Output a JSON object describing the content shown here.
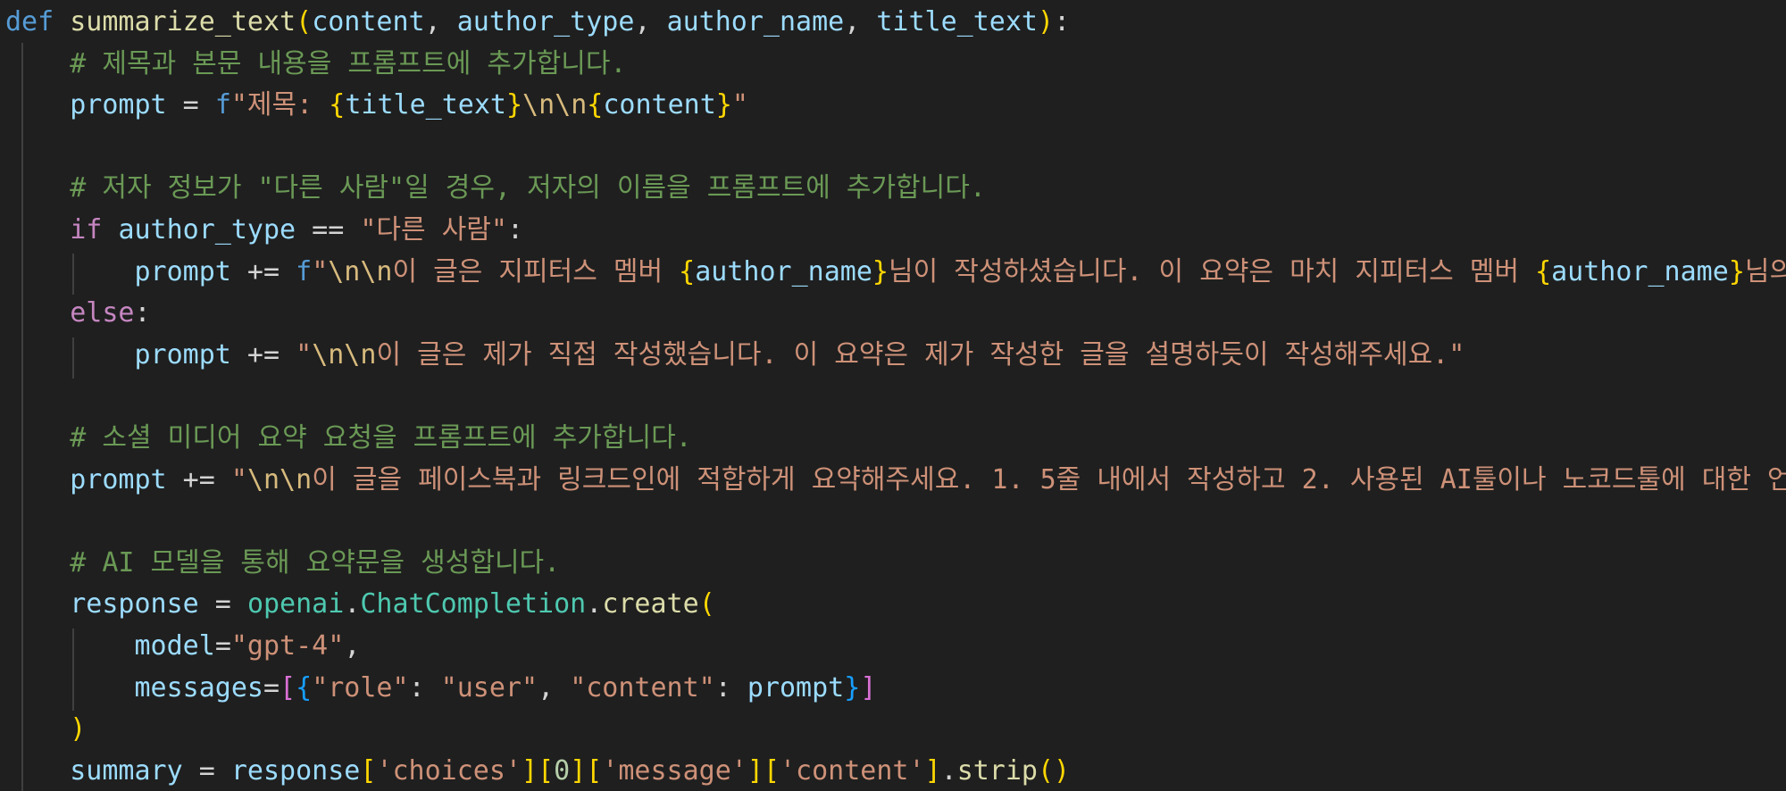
{
  "editor": {
    "language": "python",
    "theme_colors": {
      "background": "#1f1f1f",
      "keyword_def": "#569cd6",
      "keyword_control": "#c586c0",
      "function": "#dcdcaa",
      "variable": "#9cdcfe",
      "string": "#ce9178",
      "comment": "#6a9955",
      "escape": "#d7ba7d",
      "bracket_1": "#ffd700",
      "bracket_2": "#da70d6",
      "bracket_3": "#179fff",
      "class": "#4ec9b0",
      "number": "#b5cea8"
    },
    "lines": [
      [
        {
          "t": "def",
          "c": "kw-def"
        },
        {
          "t": " ",
          "c": "punc"
        },
        {
          "t": "summarize_text",
          "c": "fn"
        },
        {
          "t": "(",
          "c": "brace-y"
        },
        {
          "t": "content",
          "c": "var"
        },
        {
          "t": ", ",
          "c": "punc"
        },
        {
          "t": "author_type",
          "c": "var"
        },
        {
          "t": ", ",
          "c": "punc"
        },
        {
          "t": "author_name",
          "c": "var"
        },
        {
          "t": ", ",
          "c": "punc"
        },
        {
          "t": "title_text",
          "c": "var"
        },
        {
          "t": ")",
          "c": "brace-y"
        },
        {
          "t": ":",
          "c": "punc"
        }
      ],
      [
        {
          "t": "    ",
          "c": "punc"
        },
        {
          "t": "# 제목과 본문 내용을 프롬프트에 추가합니다.",
          "c": "comment"
        }
      ],
      [
        {
          "t": "    ",
          "c": "punc"
        },
        {
          "t": "prompt",
          "c": "var"
        },
        {
          "t": " = ",
          "c": "punc"
        },
        {
          "t": "f",
          "c": "kw-def"
        },
        {
          "t": "\"제목: ",
          "c": "str"
        },
        {
          "t": "{",
          "c": "brace-y"
        },
        {
          "t": "title_text",
          "c": "var"
        },
        {
          "t": "}",
          "c": "brace-y"
        },
        {
          "t": "\\n\\n",
          "c": "esc"
        },
        {
          "t": "{",
          "c": "brace-y"
        },
        {
          "t": "content",
          "c": "var"
        },
        {
          "t": "}",
          "c": "brace-y"
        },
        {
          "t": "\"",
          "c": "str"
        }
      ],
      [],
      [
        {
          "t": "    ",
          "c": "punc"
        },
        {
          "t": "# 저자 정보가 \"다른 사람\"일 경우, 저자의 이름을 프롬프트에 추가합니다.",
          "c": "comment"
        }
      ],
      [
        {
          "t": "    ",
          "c": "punc"
        },
        {
          "t": "if",
          "c": "kw"
        },
        {
          "t": " ",
          "c": "punc"
        },
        {
          "t": "author_type",
          "c": "var"
        },
        {
          "t": " == ",
          "c": "punc"
        },
        {
          "t": "\"다른 사람\"",
          "c": "str"
        },
        {
          "t": ":",
          "c": "punc"
        }
      ],
      [
        {
          "t": "        ",
          "c": "punc"
        },
        {
          "t": "prompt",
          "c": "var"
        },
        {
          "t": " += ",
          "c": "punc"
        },
        {
          "t": "f",
          "c": "kw-def"
        },
        {
          "t": "\"",
          "c": "str"
        },
        {
          "t": "\\n\\n",
          "c": "esc"
        },
        {
          "t": "이 글은 지피터스 멤버 ",
          "c": "str"
        },
        {
          "t": "{",
          "c": "brace-y"
        },
        {
          "t": "author_name",
          "c": "var"
        },
        {
          "t": "}",
          "c": "brace-y"
        },
        {
          "t": "님이 작성하셨습니다. 이 요약은 마치 지피터스 멤버 ",
          "c": "str"
        },
        {
          "t": "{",
          "c": "brace-y"
        },
        {
          "t": "author_name",
          "c": "var"
        },
        {
          "t": "}",
          "c": "brace-y"
        },
        {
          "t": "님의",
          "c": "str"
        }
      ],
      [
        {
          "t": "    ",
          "c": "punc"
        },
        {
          "t": "else",
          "c": "kw"
        },
        {
          "t": ":",
          "c": "punc"
        }
      ],
      [
        {
          "t": "        ",
          "c": "punc"
        },
        {
          "t": "prompt",
          "c": "var"
        },
        {
          "t": " += ",
          "c": "punc"
        },
        {
          "t": "\"",
          "c": "str"
        },
        {
          "t": "\\n\\n",
          "c": "esc"
        },
        {
          "t": "이 글은 제가 직접 작성했습니다. 이 요약은 제가 작성한 글을 설명하듯이 작성해주세요.\"",
          "c": "str"
        }
      ],
      [],
      [
        {
          "t": "    ",
          "c": "punc"
        },
        {
          "t": "# 소셜 미디어 요약 요청을 프롬프트에 추가합니다.",
          "c": "comment"
        }
      ],
      [
        {
          "t": "    ",
          "c": "punc"
        },
        {
          "t": "prompt",
          "c": "var"
        },
        {
          "t": " += ",
          "c": "punc"
        },
        {
          "t": "\"",
          "c": "str"
        },
        {
          "t": "\\n\\n",
          "c": "esc"
        },
        {
          "t": "이 글을 페이스북과 링크드인에 적합하게 요약해주세요. 1. 5줄 내에서 작성하고 2. 사용된 AI툴이나 노코드툴에 대한 언급",
          "c": "str"
        }
      ],
      [],
      [
        {
          "t": "    ",
          "c": "punc"
        },
        {
          "t": "# AI 모델을 통해 요약문을 생성합니다.",
          "c": "comment"
        }
      ],
      [
        {
          "t": "    ",
          "c": "punc"
        },
        {
          "t": "response",
          "c": "var"
        },
        {
          "t": " = ",
          "c": "punc"
        },
        {
          "t": "openai",
          "c": "class"
        },
        {
          "t": ".",
          "c": "punc"
        },
        {
          "t": "ChatCompletion",
          "c": "class"
        },
        {
          "t": ".",
          "c": "punc"
        },
        {
          "t": "create",
          "c": "fn"
        },
        {
          "t": "(",
          "c": "brace-y"
        }
      ],
      [
        {
          "t": "        ",
          "c": "punc"
        },
        {
          "t": "model",
          "c": "var"
        },
        {
          "t": "=",
          "c": "punc"
        },
        {
          "t": "\"gpt-4\"",
          "c": "str"
        },
        {
          "t": ",",
          "c": "punc"
        }
      ],
      [
        {
          "t": "        ",
          "c": "punc"
        },
        {
          "t": "messages",
          "c": "var"
        },
        {
          "t": "=",
          "c": "punc"
        },
        {
          "t": "[",
          "c": "brace-p"
        },
        {
          "t": "{",
          "c": "brace-b"
        },
        {
          "t": "\"role\"",
          "c": "str"
        },
        {
          "t": ": ",
          "c": "punc"
        },
        {
          "t": "\"user\"",
          "c": "str"
        },
        {
          "t": ", ",
          "c": "punc"
        },
        {
          "t": "\"content\"",
          "c": "str"
        },
        {
          "t": ": ",
          "c": "punc"
        },
        {
          "t": "prompt",
          "c": "var"
        },
        {
          "t": "}",
          "c": "brace-b"
        },
        {
          "t": "]",
          "c": "brace-p"
        }
      ],
      [
        {
          "t": "    ",
          "c": "punc"
        },
        {
          "t": ")",
          "c": "brace-y"
        }
      ],
      [
        {
          "t": "    ",
          "c": "punc"
        },
        {
          "t": "summary",
          "c": "var"
        },
        {
          "t": " = ",
          "c": "punc"
        },
        {
          "t": "response",
          "c": "var"
        },
        {
          "t": "[",
          "c": "brace-y"
        },
        {
          "t": "'choices'",
          "c": "str"
        },
        {
          "t": "]",
          "c": "brace-y"
        },
        {
          "t": "[",
          "c": "brace-y"
        },
        {
          "t": "0",
          "c": "num"
        },
        {
          "t": "]",
          "c": "brace-y"
        },
        {
          "t": "[",
          "c": "brace-y"
        },
        {
          "t": "'message'",
          "c": "str"
        },
        {
          "t": "]",
          "c": "brace-y"
        },
        {
          "t": "[",
          "c": "brace-y"
        },
        {
          "t": "'content'",
          "c": "str"
        },
        {
          "t": "]",
          "c": "brace-y"
        },
        {
          "t": ".",
          "c": "punc"
        },
        {
          "t": "strip",
          "c": "fn"
        },
        {
          "t": "()",
          "c": "brace-y"
        }
      ]
    ]
  }
}
